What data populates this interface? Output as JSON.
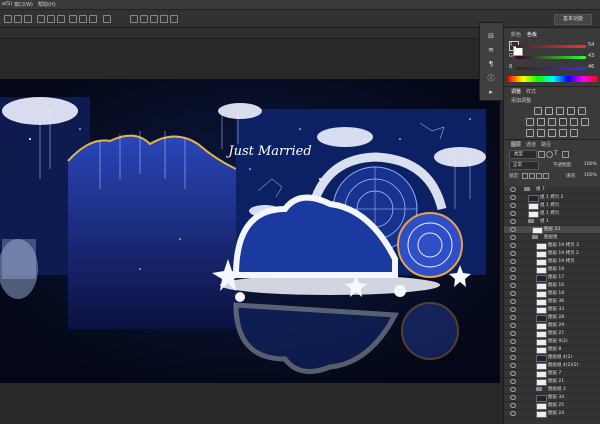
{
  "menu": [
    "a(S)",
    "窗口(W)",
    "帮助(H)"
  ],
  "workspace": {
    "label": "基本功能"
  },
  "colors": {
    "tabs": [
      "颜色",
      "色板"
    ],
    "channels": [
      {
        "label": "R",
        "value": "54",
        "color": "#e04040"
      },
      {
        "label": "G",
        "value": "43",
        "color": "#40c040"
      },
      {
        "label": "B",
        "value": "46",
        "color": "#4060e0"
      }
    ]
  },
  "adjustments": {
    "tabs": [
      "调整",
      "样式"
    ],
    "title": "添加调整"
  },
  "layers_panel": {
    "tabs": [
      "图层",
      "通道",
      "路径"
    ],
    "kind_label": "类型",
    "blend_mode": "正常",
    "opacity_label": "不透明度:",
    "opacity_value": "100%",
    "lock_label": "锁定:",
    "fill_label": "填充:",
    "fill_value": "100%",
    "rows": [
      {
        "name": "组 7",
        "type": "group",
        "indent": 0
      },
      {
        "name": "组 1 拷贝 2",
        "type": "layer",
        "indent": 1
      },
      {
        "name": "组 1 拷贝",
        "type": "layer",
        "indent": 1
      },
      {
        "name": "组 1 拷贝",
        "type": "layer",
        "indent": 1
      },
      {
        "name": "组 1",
        "type": "group",
        "indent": 1
      },
      {
        "name": "图层 23",
        "type": "layer",
        "indent": 2
      },
      {
        "name": "图层组",
        "type": "group",
        "indent": 2
      },
      {
        "name": "图层 19 拷贝 3",
        "type": "layer",
        "indent": 3
      },
      {
        "name": "图层 19 拷贝 2",
        "type": "layer",
        "indent": 3
      },
      {
        "name": "图层 19 拷贝",
        "type": "layer",
        "indent": 3
      },
      {
        "name": "图层 19",
        "type": "layer",
        "indent": 3
      },
      {
        "name": "图层 17",
        "type": "layer",
        "indent": 3
      },
      {
        "name": "图层 16",
        "type": "layer",
        "indent": 3
      },
      {
        "name": "图层 18",
        "type": "layer",
        "indent": 3
      },
      {
        "name": "图层 36",
        "type": "layer",
        "indent": 3
      },
      {
        "name": "图层 33",
        "type": "layer",
        "indent": 3
      },
      {
        "name": "图层 28",
        "type": "layer",
        "indent": 3
      },
      {
        "name": "图层 29",
        "type": "layer",
        "indent": 3
      },
      {
        "name": "图层 27",
        "type": "layer",
        "indent": 3
      },
      {
        "name": "图层 9(2)",
        "type": "layer",
        "indent": 3
      },
      {
        "name": "图层 8",
        "type": "layer",
        "indent": 3
      },
      {
        "name": "图层组 4(2)",
        "type": "layer",
        "indent": 3
      },
      {
        "name": "图层组 4(2)(2)",
        "type": "layer",
        "indent": 3
      },
      {
        "name": "图层 7",
        "type": "layer",
        "indent": 3
      },
      {
        "name": "图层 21",
        "type": "layer",
        "indent": 3
      },
      {
        "name": "图层组 3",
        "type": "group",
        "indent": 3
      },
      {
        "name": "图层 34",
        "type": "layer",
        "indent": 3
      },
      {
        "name": "图层 25",
        "type": "layer",
        "indent": 3
      },
      {
        "name": "图层 24",
        "type": "layer",
        "indent": 3
      }
    ]
  },
  "canvas": {
    "logo_text": "Just Married"
  }
}
